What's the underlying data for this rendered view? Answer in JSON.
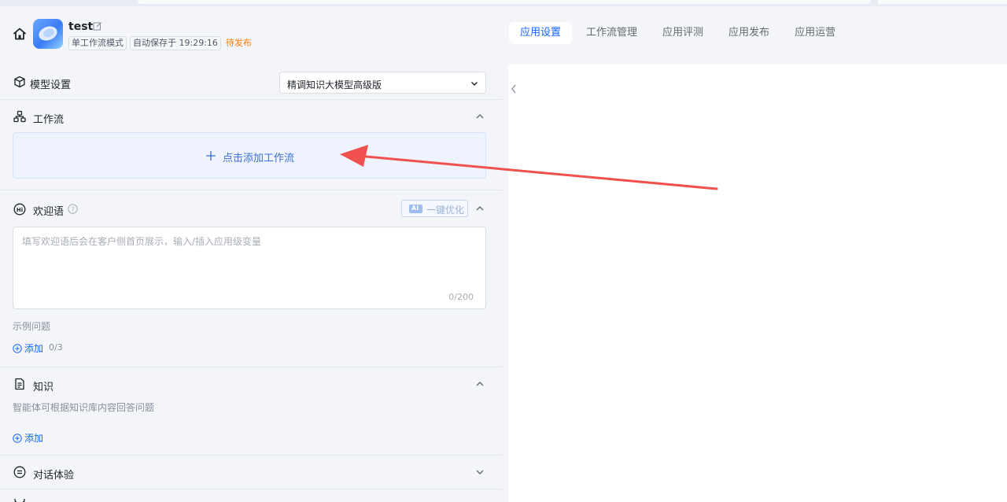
{
  "header": {
    "app_title": "test",
    "mode_tag": "单工作流模式",
    "autosave_tag": "自动保存于 19:29:16",
    "status": "待发布"
  },
  "tabs": [
    {
      "label": "应用设置",
      "active": true
    },
    {
      "label": "工作流管理",
      "active": false
    },
    {
      "label": "应用评测",
      "active": false
    },
    {
      "label": "应用发布",
      "active": false
    },
    {
      "label": "应用运营",
      "active": false
    }
  ],
  "model": {
    "title": "模型设置",
    "selected": "精调知识大模型高级版"
  },
  "workflow": {
    "title": "工作流",
    "add_label": "点击添加工作流"
  },
  "welcome": {
    "title": "欢迎语",
    "optimize_label": "一键优化",
    "ai_badge": "AI",
    "placeholder": "填写欢迎语后会在客户侧首页展示，输入/插入应用级变量",
    "char_count": "0/200",
    "sample_label": "示例问题",
    "add_label": "添加",
    "add_count": "0/3"
  },
  "knowledge": {
    "title": "知识",
    "description": "智能体可根据知识库内容回答问题",
    "add_label": "添加"
  },
  "dialog": {
    "title": "对话体验"
  },
  "colors": {
    "accent": "#1664ff",
    "status": "#ff7d00",
    "annotation_arrow": "#f0514f"
  }
}
